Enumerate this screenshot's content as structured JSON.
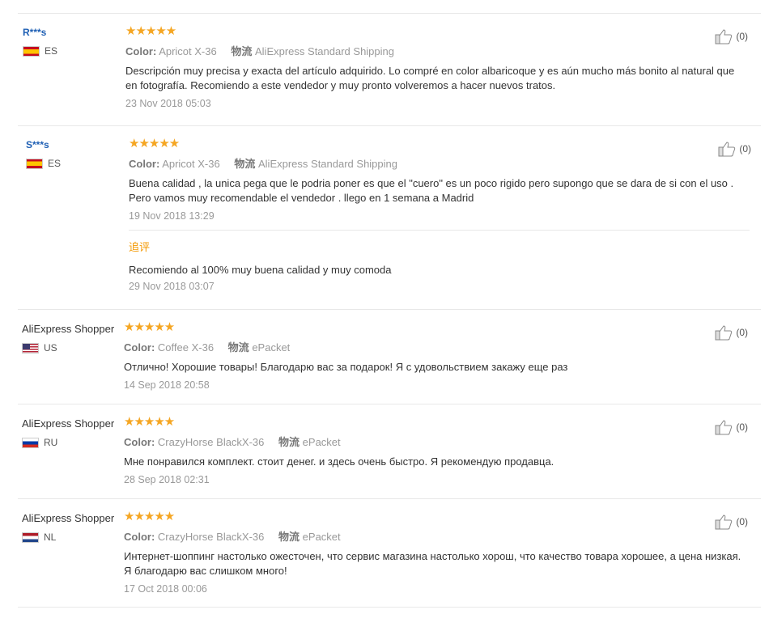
{
  "labels": {
    "color": "Color:",
    "shipping": "物流"
  },
  "followup_title": "追评",
  "reviews": [
    {
      "user": "R***s",
      "country": "ES",
      "stars": "★★★★★",
      "color": "Apricot X-36",
      "shipping": "AliExpress Standard Shipping",
      "text": "Descripción muy precisa y exacta del artículo adquirido. Lo compré en color albaricoque y es aún mucho más bonito al natural que en fotografía. Recomiendo a este vendedor y muy pronto volveremos a hacer nuevos tratos.",
      "date": "23 Nov 2018 05:03",
      "likes": "(0)"
    },
    {
      "user": "S***s",
      "country": "ES",
      "stars": "★★★★★",
      "color": "Apricot X-36",
      "shipping": "AliExpress Standard Shipping",
      "text": "Buena calidad , la unica pega que le podria poner es que el \"cuero\" es un poco rigido pero supongo que se dara de si con el uso . Pero vamos muy recomendable el vendedor . llego en 1 semana a Madrid",
      "date": "19 Nov 2018 13:29",
      "likes": "(0)",
      "followup_text": "Recomiendo al 100% muy buena calidad y muy comoda",
      "followup_date": "29 Nov 2018 03:07"
    },
    {
      "user": "AliExpress Shopper",
      "country": "US",
      "stars": "★★★★★",
      "color": "Coffee X-36",
      "shipping": "ePacket",
      "text": "Отлично! Хорошие товары! Благодарю вас за подарок! Я с удовольствием закажу еще раз",
      "date": "14 Sep 2018 20:58",
      "likes": "(0)"
    },
    {
      "user": "AliExpress Shopper",
      "country": "RU",
      "stars": "★★★★★",
      "color": "CrazyHorse BlackX-36",
      "shipping": "ePacket",
      "text": "Мне понравился комплект. стоит денег. и здесь очень быстро. Я рекомендую продавца.",
      "date": "28 Sep 2018 02:31",
      "likes": "(0)"
    },
    {
      "user": "AliExpress Shopper",
      "country": "NL",
      "stars": "★★★★★",
      "color": "CrazyHorse BlackX-36",
      "shipping": "ePacket",
      "text": "Интернет-шоппинг настолько ожесточен, что сервис магазина настолько хорош, что качество товара хорошее, а цена низкая. Я благодарю вас слишком много!",
      "date": "17 Oct 2018 00:06",
      "likes": "(0)"
    }
  ],
  "icons": {
    "like": "thumbs-up-icon"
  },
  "colors": {
    "star": "#f5a623",
    "link": "#1e5fb4",
    "followup": "#f39800"
  }
}
